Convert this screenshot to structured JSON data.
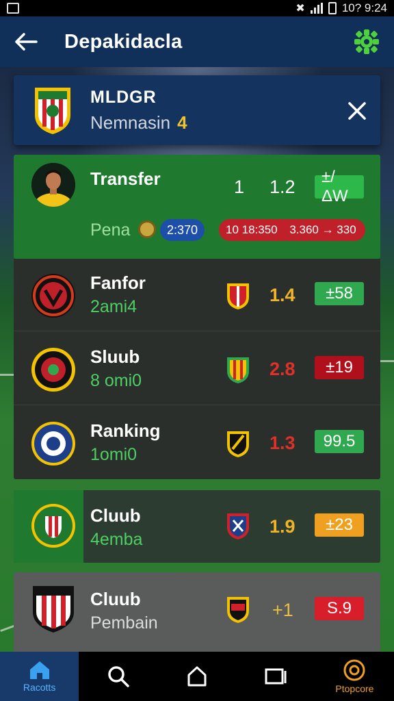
{
  "status_bar": {
    "time": "10? 9:24"
  },
  "header": {
    "title": "Depakidacla",
    "back_icon": "arrow-left-icon",
    "settings_icon": "gear-icon"
  },
  "top_card": {
    "title": "MLDGR",
    "subtitle": "Nemnasin",
    "count": "4",
    "close_icon": "close-icon"
  },
  "featured": {
    "name": "Transfer",
    "score_a": "1",
    "score_b": "1.2",
    "badge": "±/ΔW",
    "sub_label": "Pena",
    "pill_blue": "2:370",
    "pill_red_a": "10 18:350",
    "pill_red_b": "3.360 → 330"
  },
  "rows": [
    {
      "name": "Fanfor",
      "sub": "2ami4",
      "value": "1.4",
      "badge": "±58",
      "value_color": "#f0b429",
      "badge_color": "#2fa84f"
    },
    {
      "name": "Sluub",
      "sub": "8 omi0",
      "value": "2.8",
      "badge": "±19",
      "value_color": "#e0302a",
      "badge_color": "#b0101c"
    },
    {
      "name": "Ranking",
      "sub": "1omi0",
      "value": "1.3",
      "badge": "99.5",
      "value_color": "#e0302a",
      "badge_color": "#2fa84f"
    },
    {
      "name": "Cluub",
      "sub": "4emba",
      "value": "1.9",
      "badge": "±23",
      "value_color": "#f0b429",
      "badge_color": "#f0a020"
    },
    {
      "name": "Cluub",
      "sub": "Pembain",
      "value": "+1",
      "badge": "S.9",
      "value_color": "#e8c040",
      "badge_color": "#d81e2a"
    }
  ],
  "nav": [
    {
      "label": "Racotts",
      "icon": "home-icon",
      "active": true
    },
    {
      "label": "",
      "icon": "search-icon",
      "active": false
    },
    {
      "label": "",
      "icon": "house-outline-icon",
      "active": false
    },
    {
      "label": "",
      "icon": "window-icon",
      "active": false
    },
    {
      "label": "Ptopcore",
      "icon": "target-icon",
      "active": false
    }
  ],
  "colors": {
    "header": "#10305a",
    "accent_green": "#2fa84f",
    "accent_red": "#d81e2a",
    "accent_yellow": "#f0c230"
  }
}
